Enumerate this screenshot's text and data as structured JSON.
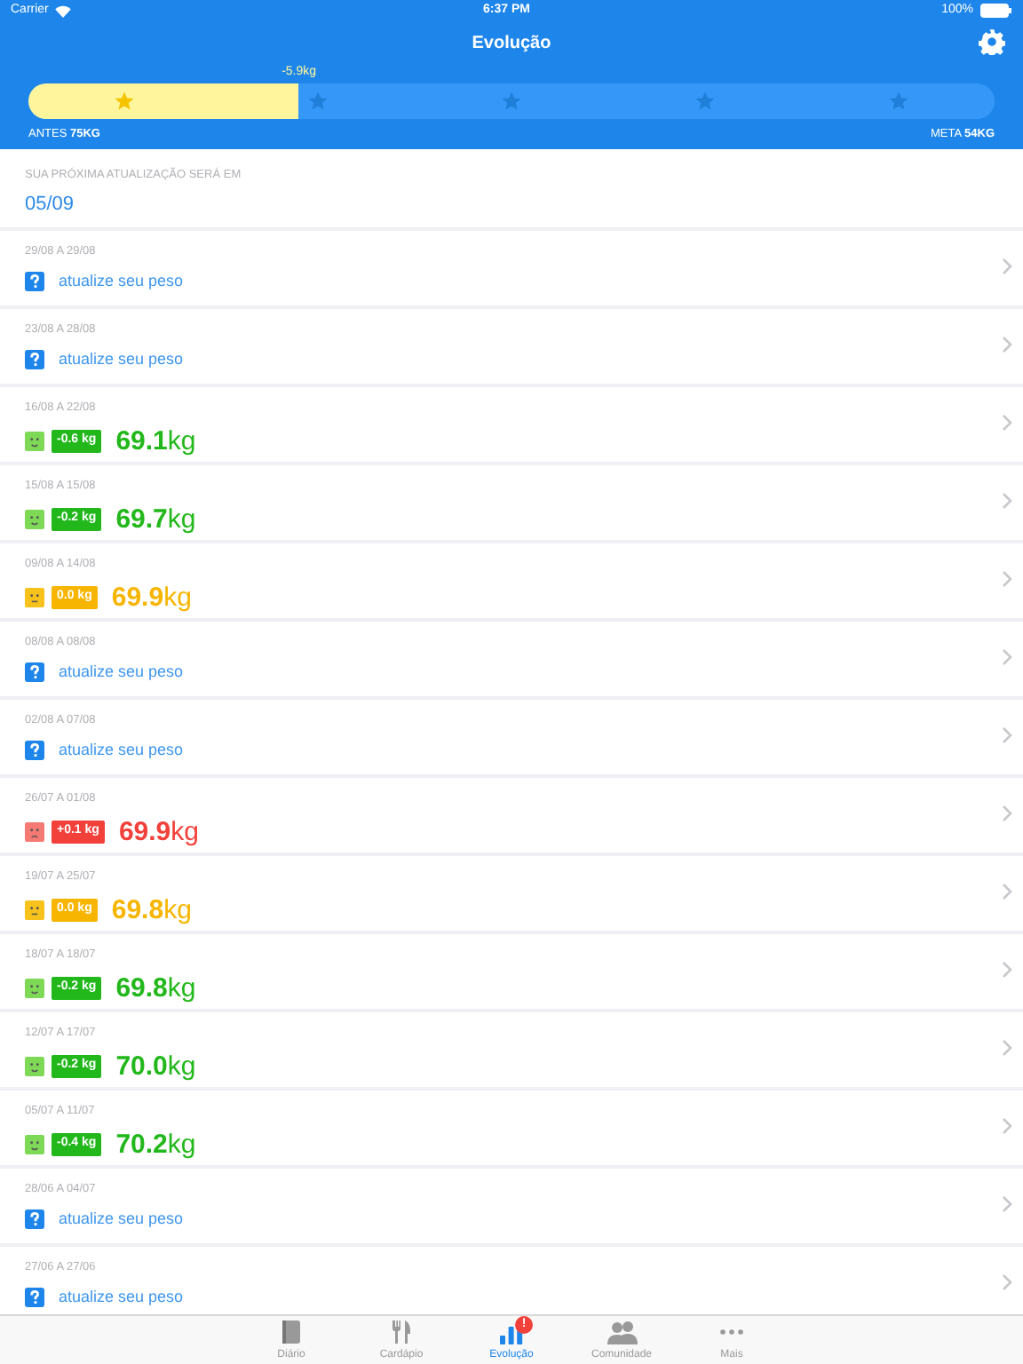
{
  "status_bar": {
    "carrier": "Carrier",
    "time": "6:37 PM",
    "battery": "100%"
  },
  "header": {
    "title": "Evolução",
    "progress": {
      "level": 0.28,
      "marker": "-5.9kg",
      "start_label": "ANTES",
      "start_value": "75KG",
      "goal_label": "META",
      "goal_value": "54KG"
    }
  },
  "next_update": {
    "label": "SUA PRÓXIMA ATUALIZAÇÃO SERÁ EM",
    "date": "05/09"
  },
  "weeks": [
    {
      "dates": "29/08 A 29/08",
      "kind": "pending",
      "text": "atualize seu peso"
    },
    {
      "dates": "23/08 A 28/08",
      "kind": "pending",
      "text": "atualize seu peso"
    },
    {
      "dates": "16/08 A 22/08",
      "kind": "loss",
      "change": "-0.6 kg",
      "weight": "**69.1**kg"
    },
    {
      "dates": "15/08 A 15/08",
      "kind": "loss",
      "change": "-0.2 kg",
      "weight": "**69.7**kg"
    },
    {
      "dates": "09/08 A 14/08",
      "kind": "same",
      "change": "0.0 kg",
      "weight": "**69.9**kg"
    },
    {
      "dates": "08/08 A 08/08",
      "kind": "pending",
      "text": "atualize seu peso"
    },
    {
      "dates": "02/08 A 07/08",
      "kind": "pending",
      "text": "atualize seu peso"
    },
    {
      "dates": "26/07 A 01/08",
      "kind": "gain",
      "change": "+0.1 kg",
      "weight": "**69.9**kg"
    },
    {
      "dates": "19/07 A 25/07",
      "kind": "same",
      "change": "0.0 kg",
      "weight": "**69.8**kg"
    },
    {
      "dates": "18/07 A 18/07",
      "kind": "loss",
      "change": "-0.2 kg",
      "weight": "**69.8**kg"
    },
    {
      "dates": "12/07 A 17/07",
      "kind": "loss",
      "change": "-0.2 kg",
      "weight": "**70.0**kg"
    },
    {
      "dates": "05/07 A 11/07",
      "kind": "loss",
      "change": "-0.4 kg",
      "weight": "**70.2**kg"
    },
    {
      "dates": "28/06 A 04/07",
      "kind": "pending",
      "text": "atualize seu peso"
    },
    {
      "dates": "27/06 A 27/06",
      "kind": "pending",
      "text": "atualize seu peso"
    }
  ],
  "tab_bar": [
    {
      "label": "Diário",
      "selected": false
    },
    {
      "label": "Cardápio",
      "selected": false
    },
    {
      "label": "Evolução",
      "selected": true,
      "badge": "!"
    },
    {
      "label": "Comunidade",
      "selected": false
    },
    {
      "label": "Mais",
      "selected": false
    }
  ]
}
